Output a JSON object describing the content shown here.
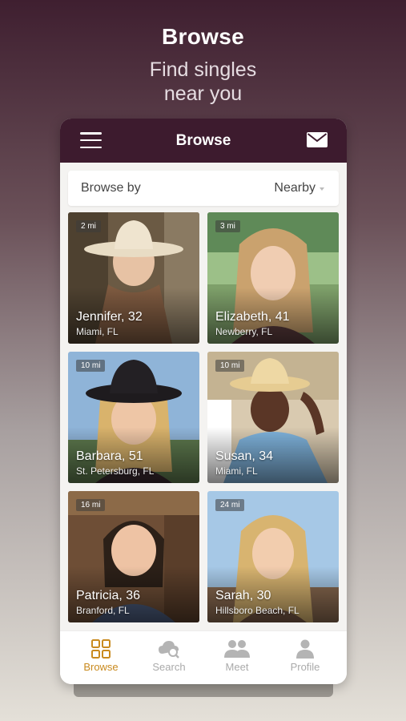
{
  "promo": {
    "title": "Browse",
    "subtitle": "Find singles\nnear you"
  },
  "header": {
    "title": "Browse"
  },
  "browse_bar": {
    "label": "Browse by",
    "selected": "Nearby"
  },
  "profiles": [
    {
      "distance": "2 mi",
      "name": "Jennifer, 32",
      "location": "Miami, FL"
    },
    {
      "distance": "3 mi",
      "name": "Elizabeth, 41",
      "location": "Newberry, FL"
    },
    {
      "distance": "10 mi",
      "name": "Barbara, 51",
      "location": "St. Petersburg, FL"
    },
    {
      "distance": "10 mi",
      "name": "Susan, 34",
      "location": "Miami, FL"
    },
    {
      "distance": "16 mi",
      "name": "Patricia, 36",
      "location": "Branford, FL"
    },
    {
      "distance": "24 mi",
      "name": "Sarah, 30",
      "location": "Hillsboro Beach, FL"
    }
  ],
  "tabs": [
    {
      "label": "Browse",
      "icon": "grid-icon",
      "active": true
    },
    {
      "label": "Search",
      "icon": "cloud-search-icon",
      "active": false
    },
    {
      "label": "Meet",
      "icon": "people-icon",
      "active": false
    },
    {
      "label": "Profile",
      "icon": "person-icon",
      "active": false
    }
  ],
  "colors": {
    "header": "#3d1b2e",
    "accent": "#c98a1e",
    "inactive": "#aaaaaa"
  }
}
